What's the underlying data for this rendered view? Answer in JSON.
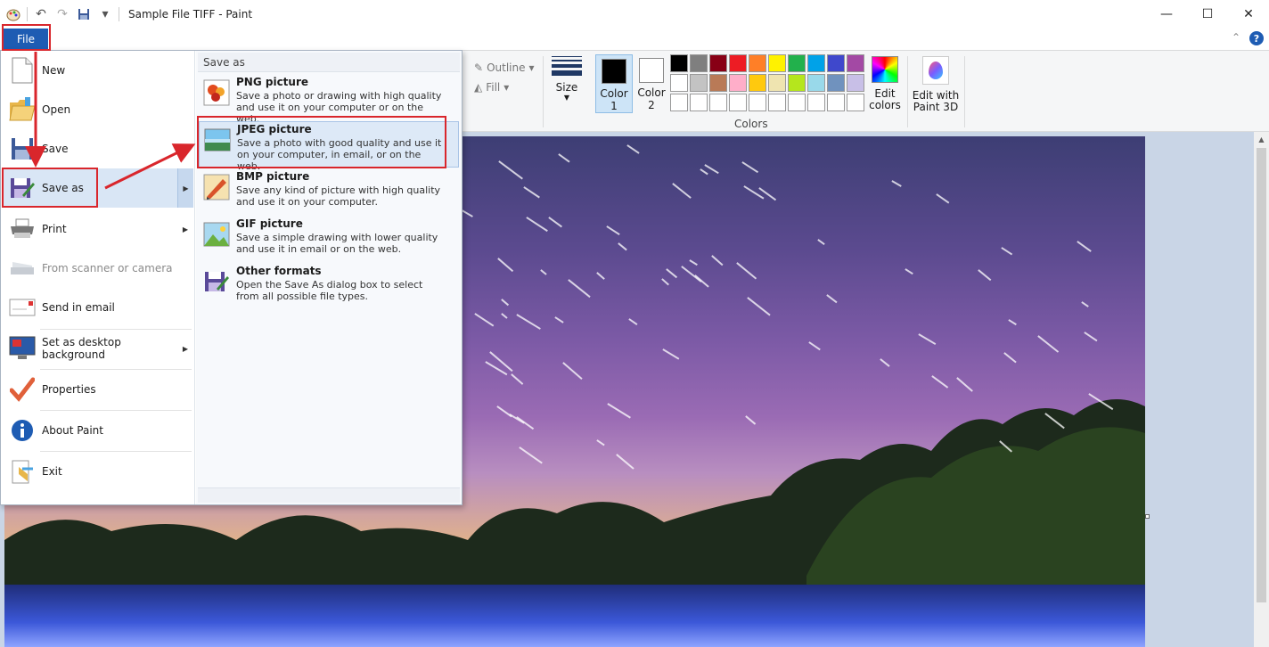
{
  "window": {
    "title": "Sample File TIFF - Paint",
    "minimize": "—",
    "maximize": "☐",
    "close": "✕"
  },
  "quick_access": {
    "icons": [
      "paint-app-icon",
      "undo-icon",
      "redo-icon",
      "save-icon",
      "customize-dropdown-icon"
    ],
    "undo": "↶",
    "redo": "↷",
    "dropdown": "▾"
  },
  "ribbon_tabs": {
    "file_label": "File",
    "collapse": "⌃",
    "help": "?"
  },
  "ribbon": {
    "outline_label": "Outline",
    "fill_label": "Fill",
    "size_label": "Size",
    "color1_label": "Color 1",
    "color2_label": "Color 2",
    "colors_group_label": "Colors",
    "edit_colors_label": "Edit colors",
    "paint3d_label": "Edit with Paint 3D",
    "color1_value": "#000000",
    "color2_value": "#ffffff",
    "palette": [
      "#000000",
      "#7f7f7f",
      "#880015",
      "#ed1c24",
      "#ff7f27",
      "#fff200",
      "#22b14c",
      "#00a2e8",
      "#3f48cc",
      "#a349a4",
      "#ffffff",
      "#c3c3c3",
      "#b97a57",
      "#ffaec9",
      "#ffc90e",
      "#efe4b0",
      "#b5e61d",
      "#99d9ea",
      "#7092be",
      "#c8bfe7",
      "#ffffff",
      "#ffffff",
      "#ffffff",
      "#ffffff",
      "#ffffff",
      "#ffffff",
      "#ffffff",
      "#ffffff",
      "#ffffff",
      "#ffffff"
    ]
  },
  "file_menu": {
    "items": [
      {
        "label": "New",
        "icon": "new-file-icon"
      },
      {
        "label": "Open",
        "icon": "open-folder-icon"
      },
      {
        "label": "Save",
        "icon": "save-disk-icon"
      },
      {
        "label": "Save as",
        "icon": "save-as-icon",
        "submenu": true
      },
      {
        "label": "Print",
        "icon": "printer-icon",
        "submenu": true
      },
      {
        "label": "From scanner or camera",
        "icon": "scanner-icon",
        "disabled": true
      },
      {
        "label": "Send in email",
        "icon": "email-icon"
      },
      {
        "label": "Set as desktop background",
        "icon": "desktop-icon",
        "submenu": true
      },
      {
        "label": "Properties",
        "icon": "checkmark-icon"
      },
      {
        "label": "About Paint",
        "icon": "info-icon"
      },
      {
        "label": "Exit",
        "icon": "exit-icon"
      }
    ],
    "submenu_arrow": "▶"
  },
  "save_as": {
    "header": "Save as",
    "options": [
      {
        "title": "PNG picture",
        "desc": "Save a photo or drawing with high quality and use it on your computer or on the web.",
        "icon": "png-picture-icon"
      },
      {
        "title": "JPEG picture",
        "desc": "Save a photo with good quality and use it on your computer, in email, or on the web.",
        "icon": "jpeg-picture-icon"
      },
      {
        "title": "BMP picture",
        "desc": "Save any kind of picture with high quality and use it on your computer.",
        "icon": "bmp-picture-icon"
      },
      {
        "title": "GIF picture",
        "desc": "Save a simple drawing with lower quality and use it in email or on the web.",
        "icon": "gif-picture-icon"
      },
      {
        "title": "Other formats",
        "desc": "Open the Save As dialog box to select from all possible file types.",
        "icon": "other-formats-icon"
      }
    ]
  },
  "canvas": {
    "image": "night sky star-trail landscape photo"
  },
  "colors": {
    "accent": "#1e5cb3",
    "annotation_red": "#d9262c",
    "highlight": "#dde9f7"
  }
}
